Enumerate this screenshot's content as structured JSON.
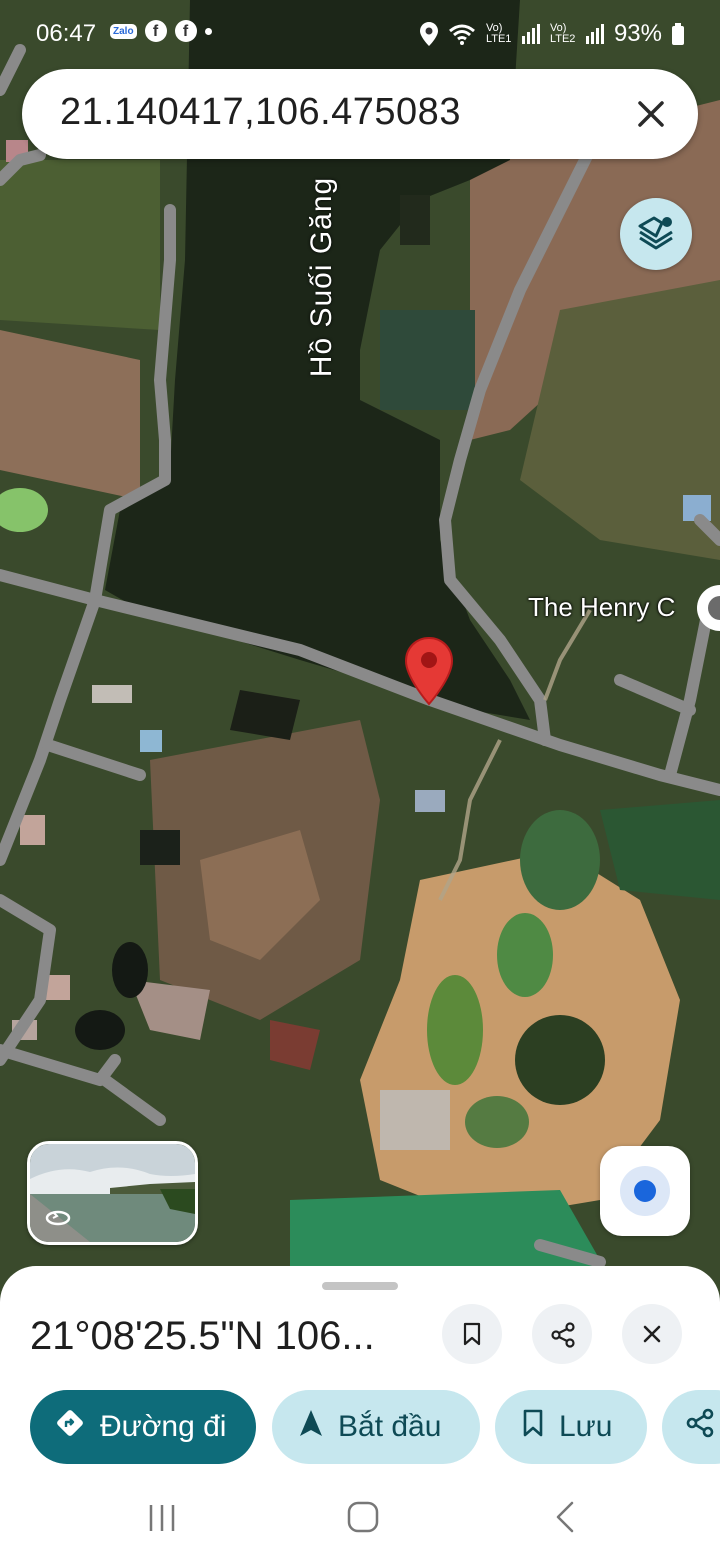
{
  "status_bar": {
    "time": "06:47",
    "app_icons": [
      "Zalo",
      "f",
      "f"
    ],
    "signal_1": "Vo) LTE1",
    "signal_2": "Vo) LTE2",
    "battery": "93%"
  },
  "search": {
    "query": "21.140417,106.475083"
  },
  "map": {
    "lake_label": "Hồ Suối Găng",
    "place_label": "The Henry C"
  },
  "bottom_sheet": {
    "coordinates": "21°08'25.5\"N 106...",
    "actions": {
      "directions": "Đường đi",
      "start": "Bắt đầu",
      "save": "Lưu"
    }
  },
  "colors": {
    "primary": "#0e6c7a",
    "chip_bg": "#c6e7ee",
    "pin": "#e53935",
    "my_location": "#1a66dc"
  },
  "icons": [
    "location-icon",
    "wifi-icon",
    "signal-icon",
    "battery-icon",
    "close-icon",
    "layers-icon",
    "map-pin-icon",
    "rotate-icon",
    "my-location-icon",
    "bookmark-icon",
    "share-icon",
    "directions-icon",
    "navigation-arrow-icon",
    "recents-icon",
    "home-icon",
    "back-icon"
  ]
}
